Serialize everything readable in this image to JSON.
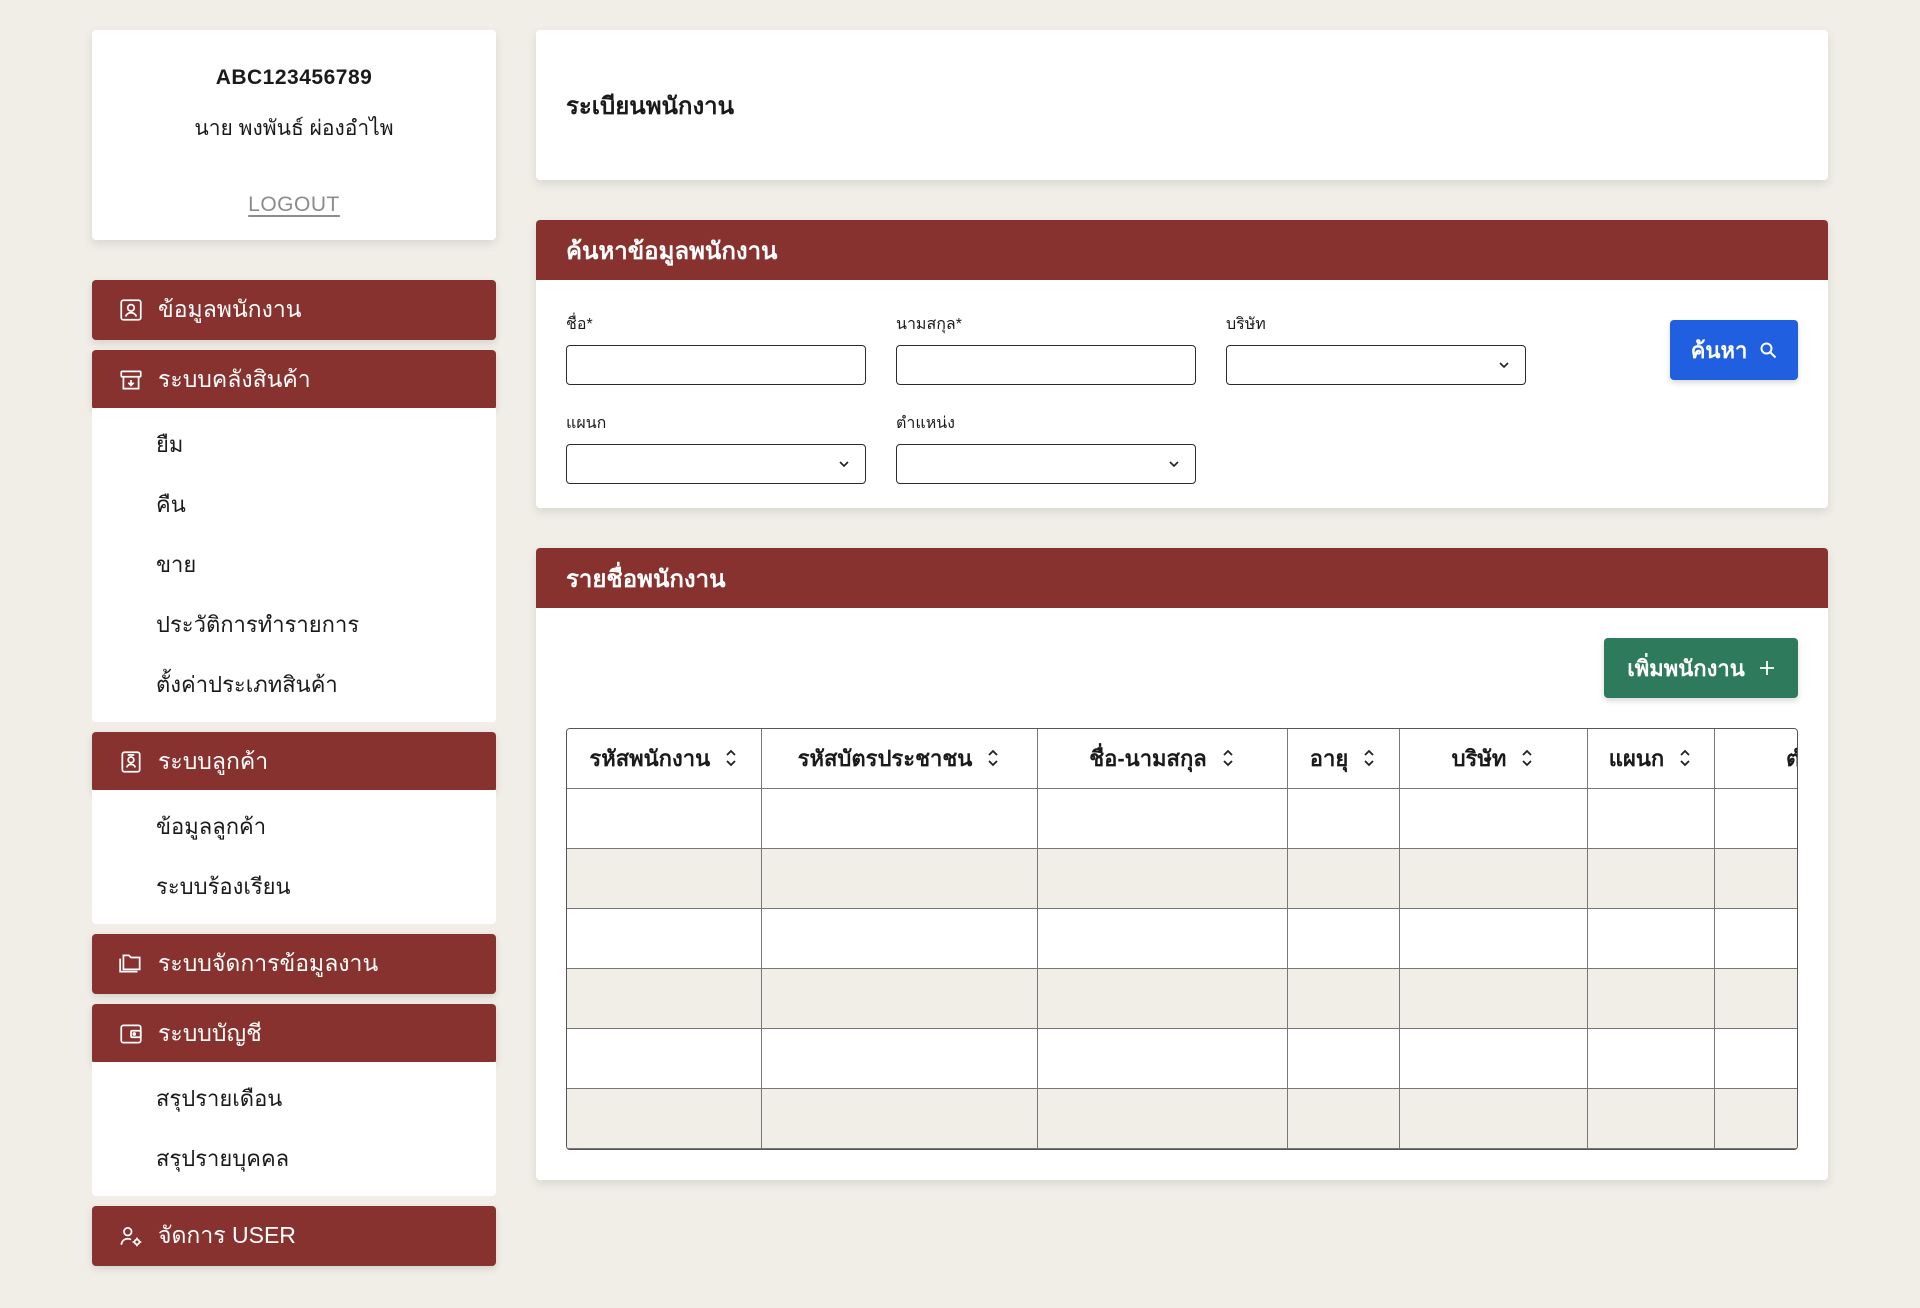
{
  "user": {
    "code": "ABC123456789",
    "name": "นาย พงพันธ์ ผ่องอำไพ",
    "logout_label": "LOGOUT"
  },
  "sidebar": {
    "groups": [
      {
        "label": "ข้อมูลพนักงาน",
        "icon": "employee-badge-icon",
        "items": []
      },
      {
        "label": "ระบบคลังสินค้า",
        "icon": "archive-box-icon",
        "items": [
          "ยืม",
          "คืน",
          "ขาย",
          "ประวัติการทำรายการ",
          "ตั้งค่าประเภทสินค้า"
        ]
      },
      {
        "label": "ระบบลูกค้า",
        "icon": "contact-card-icon",
        "items": [
          "ข้อมูลลูกค้า",
          "ระบบร้องเรียน"
        ]
      },
      {
        "label": "ระบบจัดการข้อมูลงาน",
        "icon": "folders-icon",
        "items": []
      },
      {
        "label": "ระบบบัญชี",
        "icon": "wallet-icon",
        "items": [
          "สรุปรายเดือน",
          "สรุปรายบุคคล"
        ]
      },
      {
        "label": "จัดการ USER",
        "icon": "user-settings-icon",
        "items": []
      }
    ]
  },
  "main": {
    "page_title": "ระเบียนพนักงาน",
    "search_panel": {
      "title": "ค้นหาข้อมูลพนักงาน",
      "fields": {
        "first_name": {
          "label": "ชื่อ*",
          "value": ""
        },
        "last_name": {
          "label": "นามสกุล*",
          "value": ""
        },
        "company": {
          "label": "บริษัท",
          "value": ""
        },
        "department": {
          "label": "แผนก",
          "value": ""
        },
        "position": {
          "label": "ตำแหน่ง",
          "value": ""
        }
      },
      "search_button": "ค้นหา"
    },
    "list_panel": {
      "title": "รายชื่อพนักงาน",
      "add_button": "เพิ่มพนักงาน",
      "columns": [
        "รหัสพนักงาน",
        "รหัสบัตรประชาชน",
        "ชื่อ-นามสกุล",
        "อายุ",
        "บริษัท",
        "แผนก",
        "ตำแหน่ง"
      ],
      "rows": [
        [
          "",
          "",
          "",
          "",
          "",
          "",
          ""
        ],
        [
          "",
          "",
          "",
          "",
          "",
          "",
          ""
        ],
        [
          "",
          "",
          "",
          "",
          "",
          "",
          ""
        ],
        [
          "",
          "",
          "",
          "",
          "",
          "",
          ""
        ],
        [
          "",
          "",
          "",
          "",
          "",
          "",
          ""
        ],
        [
          "",
          "",
          "",
          "",
          "",
          "",
          ""
        ]
      ]
    }
  },
  "colors": {
    "background": "#f1eee8",
    "brand_header": "#87322e",
    "search_button": "#1f5fe0",
    "add_button": "#2e7a5c",
    "row_alt": "#f1eee8"
  }
}
